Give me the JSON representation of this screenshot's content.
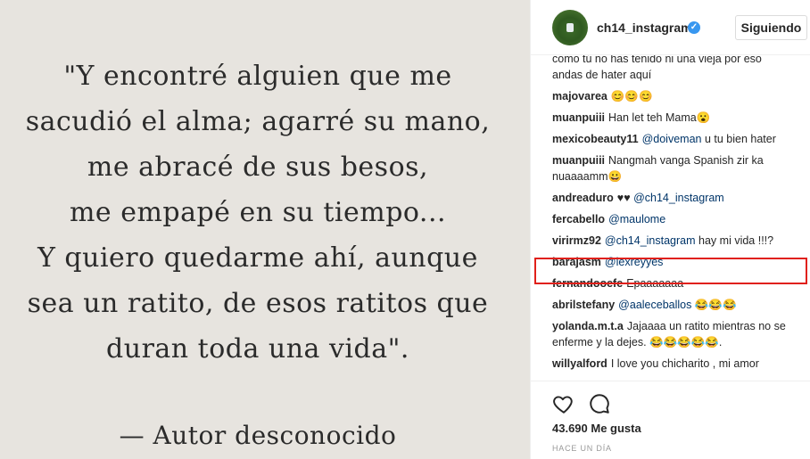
{
  "post": {
    "quote_lines": [
      "\"Y encontré alguien que me",
      "sacudió el alma; agarré su mano,",
      "me abracé de sus besos,",
      "me empapé en su tiempo...",
      "Y quiero quedarme ahí, aunque",
      "sea un ratito, de esos ratitos que",
      "duran toda una vida\"."
    ],
    "author": "— Autor desconocido"
  },
  "header": {
    "username": "ch14_instagram",
    "verified_icon": "verified-badge-icon",
    "follow_label": "Siguiendo"
  },
  "comments": [
    {
      "user": "",
      "mention": "",
      "text": "como tú no has tenido ni una vieja por eso andas de hater aquí"
    },
    {
      "user": "majovarea",
      "mention": "",
      "text": "😊😊😊"
    },
    {
      "user": "muanpuiii",
      "mention": "",
      "text": "Han let teh Mama😮"
    },
    {
      "user": "mexicobeauty11",
      "mention": "@doiveman",
      "text": "u tu bien hater"
    },
    {
      "user": "muanpuiii",
      "mention": "",
      "text": "Nangmah vanga Spanish zir ka nuaaaamm😀"
    },
    {
      "user": "andreaduro",
      "mention": "@ch14_instagram",
      "text": "♥♥"
    },
    {
      "user": "fercabello",
      "mention": "@maulome",
      "text": ""
    },
    {
      "user": "virirmz92",
      "mention": "@ch14_instagram",
      "text": "hay mi vida !!!?"
    },
    {
      "user": "barajasm",
      "mention": "@lexreyyes",
      "text": ""
    },
    {
      "user": "fernandooefe",
      "mention": "",
      "text": "Epaaaaaaa"
    },
    {
      "user": "abrilstefany",
      "mention": "@aaleceballos",
      "text": "😂😂😂"
    },
    {
      "user": "yolanda.m.t.a",
      "mention": "",
      "text": "Jajaaaa un ratito mientras no se enferme y la dejes. 😂😂😂😂😂."
    },
    {
      "user": "willyalford",
      "mention": "",
      "text": "I love you chicharito , mi amor"
    }
  ],
  "actions": {
    "like_icon": "heart-icon",
    "comment_icon": "comment-bubble-icon",
    "likes": "43.690 Me gusta",
    "time": "HACE UN DÍA"
  },
  "colors": {
    "highlight": "#e0201a",
    "mention": "#003569",
    "verified": "#3897f0"
  }
}
